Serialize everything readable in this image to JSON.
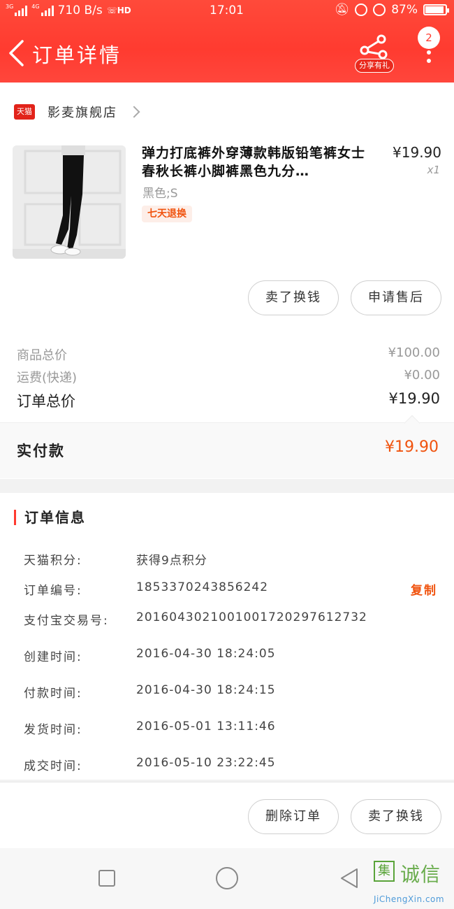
{
  "status_bar": {
    "network_a": "3G",
    "network_b": "4G",
    "speed": "710 B/s",
    "hd": "HD",
    "time": "17:01",
    "battery": "87%",
    "battery_level": 0.87
  },
  "header": {
    "title": "订单详情",
    "share_label": "分享有礼",
    "message_count": "2",
    "accent_color": "#ff3b30"
  },
  "store": {
    "platform_badge": "天猫",
    "name": "影麦旗舰店"
  },
  "product": {
    "title": "弹力打底裤外穿薄款韩版铅笔裤女士春秋长裤小脚裤黑色九分…",
    "price": "¥19.90",
    "quantity": "x1",
    "sku": "黑色;S",
    "tag": "七天退换"
  },
  "item_actions": {
    "sell_for_cash": "卖了换钱",
    "after_sale": "申请售后"
  },
  "fees": {
    "goods_total_label": "商品总价",
    "goods_total_value": "¥100.00",
    "shipping_label": "运费(快递)",
    "shipping_value": "¥0.00",
    "order_total_label": "订单总价",
    "order_total_value": "¥19.90",
    "paid_label": "实付款",
    "paid_value": "¥19.90"
  },
  "order_info": {
    "section_title": "订单信息",
    "copy_label": "复制",
    "rows": [
      {
        "label": "天猫积分:",
        "value": "获得9点积分"
      },
      {
        "label": "订单编号:",
        "value": "1853370243856242"
      },
      {
        "label": "支付宝交易号:",
        "value": "2016043021001001720297612732"
      },
      {
        "label": "创建时间:",
        "value": "2016-04-30 18:24:05"
      },
      {
        "label": "付款时间:",
        "value": "2016-04-30 18:24:15"
      },
      {
        "label": "发货时间:",
        "value": "2016-05-01 13:11:46"
      },
      {
        "label": "成交时间:",
        "value": "2016-05-10 23:22:45"
      }
    ]
  },
  "bottom_actions": {
    "delete_order": "删除订单",
    "sell_for_cash": "卖了换钱"
  },
  "watermark": {
    "logo_char": "集",
    "cn": "诚信",
    "en": "JiChengXin.com"
  }
}
